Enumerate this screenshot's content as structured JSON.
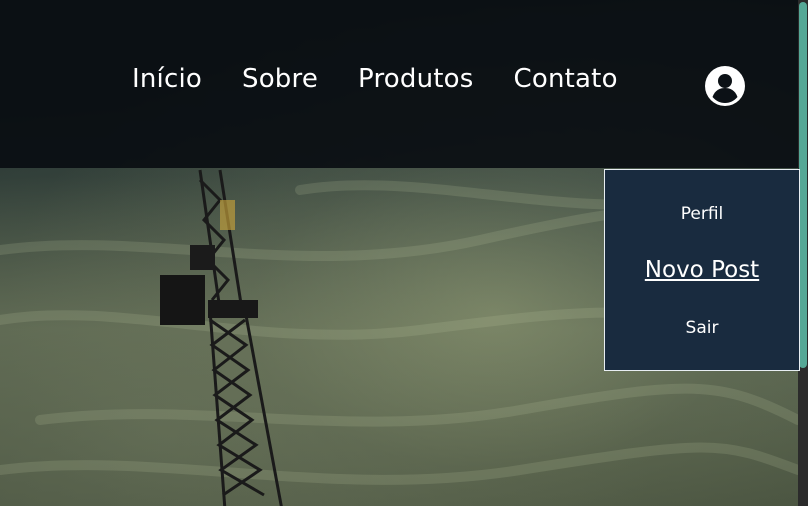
{
  "nav": {
    "items": [
      {
        "label": "Início"
      },
      {
        "label": "Sobre"
      },
      {
        "label": "Produtos"
      },
      {
        "label": "Contato"
      }
    ],
    "user_icon": "user-circle-icon"
  },
  "dropdown": {
    "items": [
      {
        "label": "Perfil"
      },
      {
        "label": "Novo Post"
      },
      {
        "label": "Sair"
      }
    ]
  },
  "colors": {
    "navbar": "#0a0e12",
    "dropdown_bg": "#192b3f",
    "scrollbar_thumb": "#55a896"
  }
}
